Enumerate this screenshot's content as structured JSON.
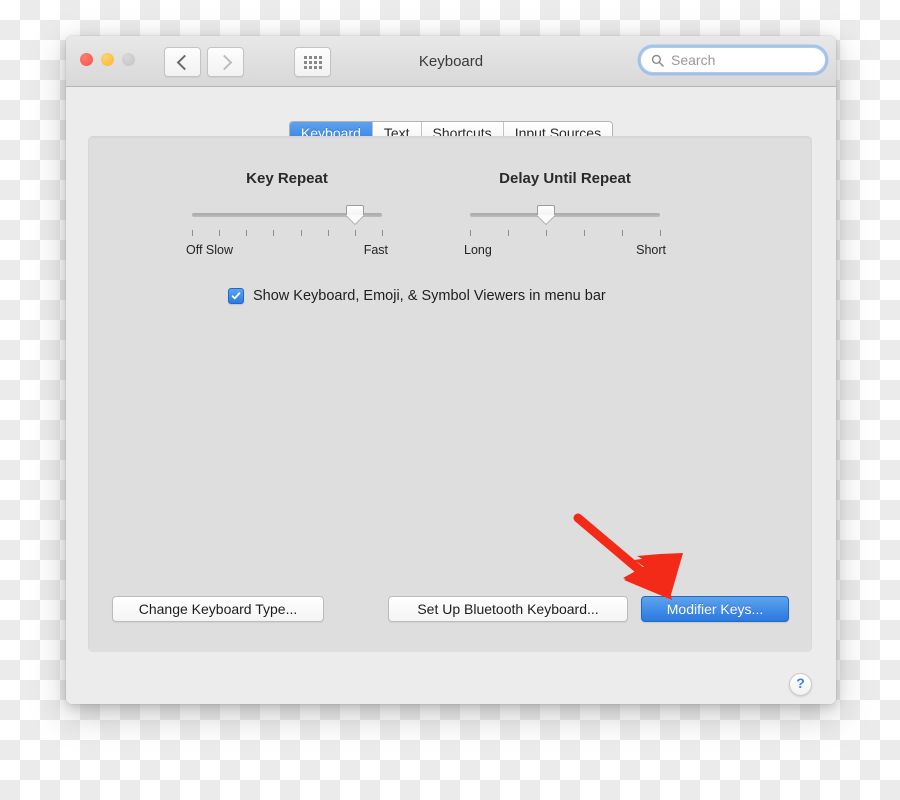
{
  "window": {
    "title": "Keyboard",
    "traffic_lights": [
      {
        "name": "close",
        "color": "#f9524a"
      },
      {
        "name": "minimize",
        "color": "#f9b72f"
      },
      {
        "name": "zoom",
        "color": "#c2c2c2"
      }
    ],
    "nav": {
      "back_label": "Back",
      "forward_label": "Forward",
      "grid_label": "Show All"
    },
    "search": {
      "placeholder": "Search",
      "value": "",
      "icon": "search-icon"
    },
    "help": {
      "label": "?"
    }
  },
  "tabs": [
    {
      "label": "Keyboard",
      "selected": true
    },
    {
      "label": "Text",
      "selected": false
    },
    {
      "label": "Shortcuts",
      "selected": false
    },
    {
      "label": "Input Sources",
      "selected": false
    }
  ],
  "sliders": [
    {
      "title": "Key Repeat",
      "low_label": "Off Slow",
      "high_label": "Fast",
      "ticks": 8,
      "value_index": 7,
      "value_percent": 86
    },
    {
      "title": "Delay Until Repeat",
      "low_label": "Long",
      "high_label": "Short",
      "ticks": 6,
      "value_index": 3,
      "value_percent": 40
    }
  ],
  "checkbox": {
    "label": "Show Keyboard, Emoji, & Symbol Viewers in menu bar",
    "checked": true
  },
  "buttons": [
    {
      "label": "Change Keyboard Type...",
      "style": "plain"
    },
    {
      "label": "Set Up Bluetooth Keyboard...",
      "style": "plain"
    },
    {
      "label": "Modifier Keys...",
      "style": "primary"
    }
  ],
  "annotation": {
    "type": "arrow",
    "color": "#f42a18",
    "points_to": "Modifier Keys..."
  },
  "colors": {
    "accent_blue": "#2d79e0",
    "window_bg": "#ececec",
    "panel_bg": "#dedede",
    "annotation_red": "#f42a18"
  }
}
